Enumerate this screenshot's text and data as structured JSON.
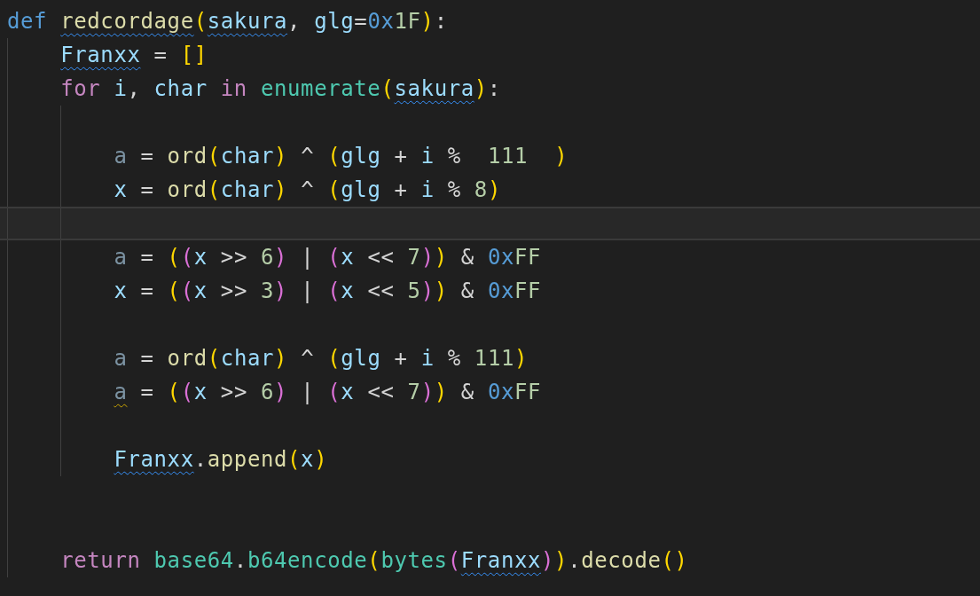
{
  "editor": {
    "lines": [
      {
        "current": false,
        "tokens": [
          {
            "text": "def ",
            "kind": "keyword"
          },
          {
            "text": "redcordage",
            "kind": "function",
            "underlined": true
          },
          {
            "text": "(",
            "kind": "bracket1"
          },
          {
            "text": "sakura",
            "kind": "variable",
            "underlined": true
          },
          {
            "text": ", ",
            "kind": "operator"
          },
          {
            "text": "glg",
            "kind": "variable"
          },
          {
            "text": "=",
            "kind": "operator"
          },
          {
            "text": "0x",
            "kind": "keyword"
          },
          {
            "text": "1F",
            "kind": "number"
          },
          {
            "text": ")",
            "kind": "bracket1"
          },
          {
            "text": ":",
            "kind": "operator"
          }
        ],
        "children": [
          {
            "current": false,
            "tokens": [
              {
                "text": "Franxx",
                "kind": "variable",
                "underlined": true
              },
              {
                "text": " = ",
                "kind": "operator"
              },
              {
                "text": "[]",
                "kind": "bracket1"
              }
            ]
          },
          {
            "current": false,
            "tokens": [
              {
                "text": "for ",
                "kind": "control"
              },
              {
                "text": "i",
                "kind": "variable"
              },
              {
                "text": ", ",
                "kind": "operator"
              },
              {
                "text": "char ",
                "kind": "variable"
              },
              {
                "text": "in ",
                "kind": "control"
              },
              {
                "text": "enumerate",
                "kind": "builtin"
              },
              {
                "text": "(",
                "kind": "bracket1"
              },
              {
                "text": "sakura",
                "kind": "variable",
                "underlined": true
              },
              {
                "text": ")",
                "kind": "bracket1"
              },
              {
                "text": ":",
                "kind": "operator"
              }
            ],
            "children": [
              {
                "current": false
              },
              {
                "current": false,
                "tokens": [
                  {
                    "text": "a",
                    "kind": "unused"
                  },
                  {
                    "text": " = ",
                    "kind": "operator"
                  },
                  {
                    "text": "ord",
                    "kind": "function"
                  },
                  {
                    "text": "(",
                    "kind": "bracket1"
                  },
                  {
                    "text": "char",
                    "kind": "variable"
                  },
                  {
                    "text": ")",
                    "kind": "bracket1"
                  },
                  {
                    "text": " ^ ",
                    "kind": "operator"
                  },
                  {
                    "text": "(",
                    "kind": "bracket1"
                  },
                  {
                    "text": "glg",
                    "kind": "variable"
                  },
                  {
                    "text": " + ",
                    "kind": "operator"
                  },
                  {
                    "text": "i",
                    "kind": "variable"
                  },
                  {
                    "text": " %  ",
                    "kind": "operator"
                  },
                  {
                    "text": "111",
                    "kind": "number"
                  },
                  {
                    "text": "  )",
                    "kind": "bracket1"
                  }
                ]
              },
              {
                "current": false,
                "tokens": [
                  {
                    "text": "x",
                    "kind": "variable"
                  },
                  {
                    "text": " = ",
                    "kind": "operator"
                  },
                  {
                    "text": "ord",
                    "kind": "function"
                  },
                  {
                    "text": "(",
                    "kind": "bracket1"
                  },
                  {
                    "text": "char",
                    "kind": "variable"
                  },
                  {
                    "text": ")",
                    "kind": "bracket1"
                  },
                  {
                    "text": " ^ ",
                    "kind": "operator"
                  },
                  {
                    "text": "(",
                    "kind": "bracket1"
                  },
                  {
                    "text": "glg",
                    "kind": "variable"
                  },
                  {
                    "text": " + ",
                    "kind": "operator"
                  },
                  {
                    "text": "i",
                    "kind": "variable"
                  },
                  {
                    "text": " % ",
                    "kind": "operator"
                  },
                  {
                    "text": "8",
                    "kind": "number"
                  },
                  {
                    "text": ")",
                    "kind": "bracket1"
                  }
                ]
              },
              {
                "current": true
              },
              {
                "current": false,
                "tokens": [
                  {
                    "text": "a",
                    "kind": "unused"
                  },
                  {
                    "text": " = ",
                    "kind": "operator"
                  },
                  {
                    "text": "(",
                    "kind": "bracket1"
                  },
                  {
                    "text": "(",
                    "kind": "bracket2"
                  },
                  {
                    "text": "x",
                    "kind": "variable"
                  },
                  {
                    "text": " >> ",
                    "kind": "operator"
                  },
                  {
                    "text": "6",
                    "kind": "number"
                  },
                  {
                    "text": ")",
                    "kind": "bracket2"
                  },
                  {
                    "text": " | ",
                    "kind": "operator"
                  },
                  {
                    "text": "(",
                    "kind": "bracket2"
                  },
                  {
                    "text": "x",
                    "kind": "variable"
                  },
                  {
                    "text": " << ",
                    "kind": "operator"
                  },
                  {
                    "text": "7",
                    "kind": "number"
                  },
                  {
                    "text": ")",
                    "kind": "bracket2"
                  },
                  {
                    "text": ")",
                    "kind": "bracket1"
                  },
                  {
                    "text": " & ",
                    "kind": "operator"
                  },
                  {
                    "text": "0x",
                    "kind": "keyword"
                  },
                  {
                    "text": "FF",
                    "kind": "number"
                  }
                ]
              },
              {
                "current": false,
                "tokens": [
                  {
                    "text": "x",
                    "kind": "variable"
                  },
                  {
                    "text": " = ",
                    "kind": "operator"
                  },
                  {
                    "text": "(",
                    "kind": "bracket1"
                  },
                  {
                    "text": "(",
                    "kind": "bracket2"
                  },
                  {
                    "text": "x",
                    "kind": "variable"
                  },
                  {
                    "text": " >> ",
                    "kind": "operator"
                  },
                  {
                    "text": "3",
                    "kind": "number"
                  },
                  {
                    "text": ")",
                    "kind": "bracket2"
                  },
                  {
                    "text": " | ",
                    "kind": "operator"
                  },
                  {
                    "text": "(",
                    "kind": "bracket2"
                  },
                  {
                    "text": "x",
                    "kind": "variable"
                  },
                  {
                    "text": " << ",
                    "kind": "operator"
                  },
                  {
                    "text": "5",
                    "kind": "number"
                  },
                  {
                    "text": ")",
                    "kind": "bracket2"
                  },
                  {
                    "text": ")",
                    "kind": "bracket1"
                  },
                  {
                    "text": " & ",
                    "kind": "operator"
                  },
                  {
                    "text": "0x",
                    "kind": "keyword"
                  },
                  {
                    "text": "FF",
                    "kind": "number"
                  }
                ]
              },
              {
                "current": false
              },
              {
                "current": false,
                "tokens": [
                  {
                    "text": "a",
                    "kind": "unused"
                  },
                  {
                    "text": " = ",
                    "kind": "operator"
                  },
                  {
                    "text": "ord",
                    "kind": "function"
                  },
                  {
                    "text": "(",
                    "kind": "bracket1"
                  },
                  {
                    "text": "char",
                    "kind": "variable"
                  },
                  {
                    "text": ")",
                    "kind": "bracket1"
                  },
                  {
                    "text": " ^ ",
                    "kind": "operator"
                  },
                  {
                    "text": "(",
                    "kind": "bracket1"
                  },
                  {
                    "text": "glg",
                    "kind": "variable"
                  },
                  {
                    "text": " + ",
                    "kind": "operator"
                  },
                  {
                    "text": "i",
                    "kind": "variable"
                  },
                  {
                    "text": " % ",
                    "kind": "operator"
                  },
                  {
                    "text": "111",
                    "kind": "number"
                  },
                  {
                    "text": ")",
                    "kind": "bracket1"
                  }
                ]
              },
              {
                "current": false,
                "tokens": [
                  {
                    "text": "a",
                    "kind": "unused",
                    "underlined": true,
                    "warning": true
                  },
                  {
                    "text": " = ",
                    "kind": "operator"
                  },
                  {
                    "text": "(",
                    "kind": "bracket1"
                  },
                  {
                    "text": "(",
                    "kind": "bracket2"
                  },
                  {
                    "text": "x",
                    "kind": "variable"
                  },
                  {
                    "text": " >> ",
                    "kind": "operator"
                  },
                  {
                    "text": "6",
                    "kind": "number"
                  },
                  {
                    "text": ")",
                    "kind": "bracket2"
                  },
                  {
                    "text": " | ",
                    "kind": "operator"
                  },
                  {
                    "text": "(",
                    "kind": "bracket2"
                  },
                  {
                    "text": "x",
                    "kind": "variable"
                  },
                  {
                    "text": " << ",
                    "kind": "operator"
                  },
                  {
                    "text": "7",
                    "kind": "number"
                  },
                  {
                    "text": ")",
                    "kind": "bracket2"
                  },
                  {
                    "text": ")",
                    "kind": "bracket1"
                  },
                  {
                    "text": " & ",
                    "kind": "operator"
                  },
                  {
                    "text": "0x",
                    "kind": "keyword"
                  },
                  {
                    "text": "FF",
                    "kind": "number"
                  }
                ]
              },
              {
                "current": false
              },
              {
                "current": false,
                "tokens": [
                  {
                    "text": "Franxx",
                    "kind": "variable",
                    "underlined": true
                  },
                  {
                    "text": ".",
                    "kind": "operator"
                  },
                  {
                    "text": "append",
                    "kind": "function"
                  },
                  {
                    "text": "(",
                    "kind": "bracket1"
                  },
                  {
                    "text": "x",
                    "kind": "variable"
                  },
                  {
                    "text": ")",
                    "kind": "bracket1"
                  }
                ]
              }
            ]
          },
          {
            "current": false
          },
          {
            "current": false
          },
          {
            "current": false,
            "tokens": [
              {
                "text": "return ",
                "kind": "control"
              },
              {
                "text": "base64",
                "kind": "builtin"
              },
              {
                "text": ".",
                "kind": "operator"
              },
              {
                "text": "b64encode",
                "kind": "builtin"
              },
              {
                "text": "(",
                "kind": "bracket1"
              },
              {
                "text": "bytes",
                "kind": "builtin"
              },
              {
                "text": "(",
                "kind": "bracket2"
              },
              {
                "text": "Franxx",
                "kind": "variable",
                "underlined": true
              },
              {
                "text": ")",
                "kind": "bracket2"
              },
              {
                "text": ")",
                "kind": "bracket1"
              },
              {
                "text": ".",
                "kind": "operator"
              },
              {
                "text": "decode",
                "kind": "function"
              },
              {
                "text": "()",
                "kind": "bracket1"
              }
            ]
          }
        ]
      }
    ]
  }
}
